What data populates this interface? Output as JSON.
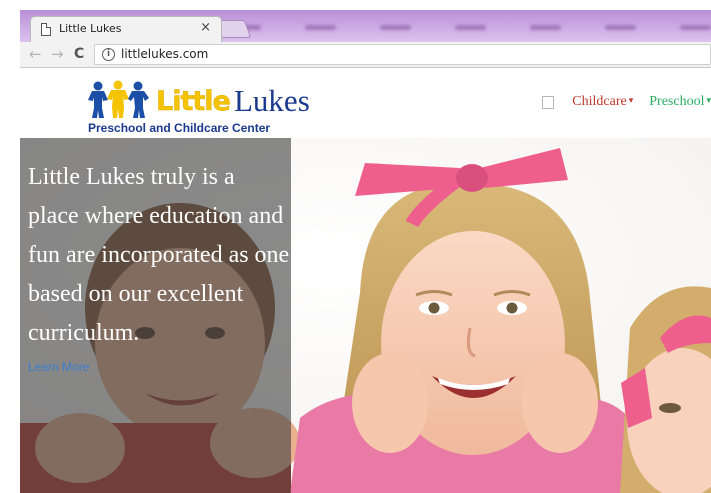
{
  "browser": {
    "tab_title": "Little Lukes",
    "close_glyph": "×",
    "back_glyph": "←",
    "forward_glyph": "→",
    "reload_glyph": "C",
    "info_glyph": "i",
    "url": "littlelukes.com",
    "tab_icon": "page-icon",
    "accent_color": "#c9a3e3"
  },
  "site": {
    "logo": {
      "word_little": "Little",
      "word_lukes": "Lukes",
      "tagline": "Preschool and Childcare Center"
    },
    "nav": [
      {
        "label": "Childcare",
        "color": "#c0392b"
      },
      {
        "label": "Preschool",
        "color": "#27ae60"
      }
    ],
    "caret_glyph": "▾",
    "hero": {
      "headline": "Little Lukes truly is a place where education and fun are incorporated as one based on our excellent curriculum.",
      "link": "Learn More"
    }
  }
}
